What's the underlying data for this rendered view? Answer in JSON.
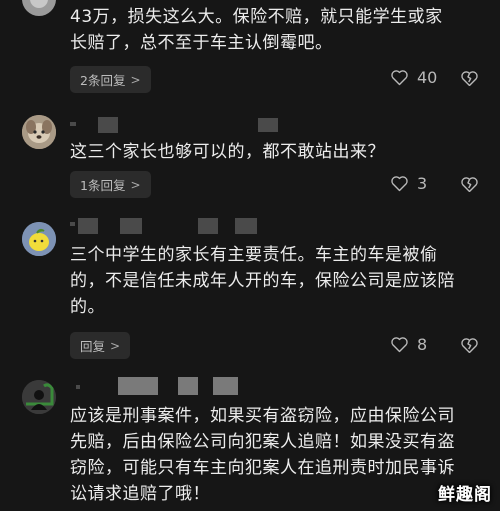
{
  "comments": [
    {
      "text_lines": [
        "43万，损失这么大。保险不赔，就只能学生或家",
        "长赔了，总不至于车主认倒霉吧。"
      ],
      "reply_label": "2条回复",
      "likes": "40",
      "avatar_icon": "avatar-gray-icon"
    },
    {
      "text_lines": [
        "这三个家长也够可以的，都不敢站出来？"
      ],
      "reply_label": "1条回复",
      "likes": "3",
      "avatar_icon": "avatar-dog-icon"
    },
    {
      "text_lines": [
        "三个中学生的家长有主要责任。车主的车是被偷",
        "的，不是信任未成年人开的车，保险公司是应该陪",
        "的。"
      ],
      "reply_label": "回复",
      "likes": "8",
      "avatar_icon": "avatar-lemon-icon"
    },
    {
      "text_lines": [
        "应该是刑事案件，如果买有盗窃险，应由保险公司",
        "先赔，后由保险公司向犯案人追赔！如果没买有盗",
        "窃险，可能只有车主向犯案人在追刑责时加民事诉",
        "讼请求追赔了哦！"
      ],
      "avatar_icon": "avatar-default-icon"
    }
  ],
  "icons": {
    "like": "heart-icon",
    "dislike": "broken-heart-icon",
    "chevron": "chevron-right-icon"
  },
  "chevron_glyph": ">",
  "watermark": "鲜趣阁",
  "colors": {
    "background": "#161616",
    "text": "#ececec",
    "chip": "#2b2b2b",
    "muted": "#b9b9b9"
  }
}
